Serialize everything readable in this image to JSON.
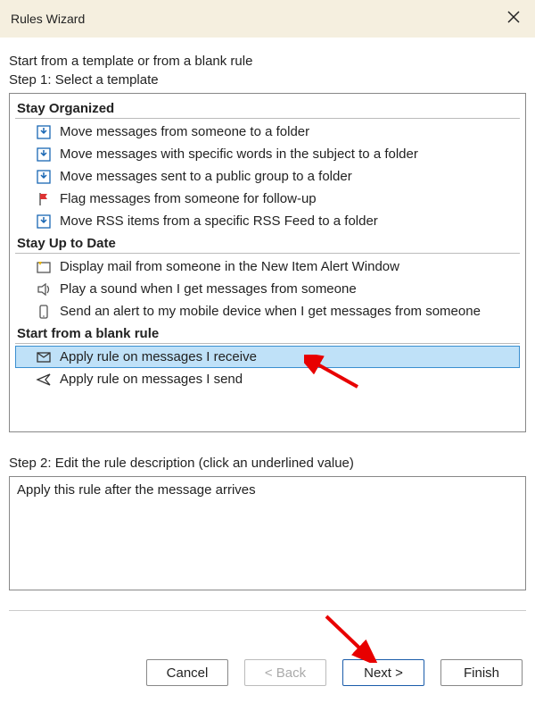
{
  "dialog": {
    "title": "Rules Wizard"
  },
  "intro": {
    "line1": "Start from a template or from a blank rule",
    "line2": "Step 1: Select a template"
  },
  "sections": {
    "stay_organized": {
      "header": "Stay Organized",
      "items": [
        "Move messages from someone to a folder",
        "Move messages with specific words in the subject to a folder",
        "Move messages sent to a public group to a folder",
        "Flag messages from someone for follow-up",
        "Move RSS items from a specific RSS Feed to a folder"
      ]
    },
    "stay_up_to_date": {
      "header": "Stay Up to Date",
      "items": [
        "Display mail from someone in the New Item Alert Window",
        "Play a sound when I get messages from someone",
        "Send an alert to my mobile device when I get messages from someone"
      ]
    },
    "blank_rule": {
      "header": "Start from a blank rule",
      "items": [
        "Apply rule on messages I receive",
        "Apply rule on messages I send"
      ],
      "selected_index": 0
    }
  },
  "step2": {
    "label": "Step 2: Edit the rule description (click an underlined value)",
    "description": "Apply this rule after the message arrives"
  },
  "buttons": {
    "cancel": "Cancel",
    "back": "< Back",
    "next": "Next >",
    "finish": "Finish"
  }
}
